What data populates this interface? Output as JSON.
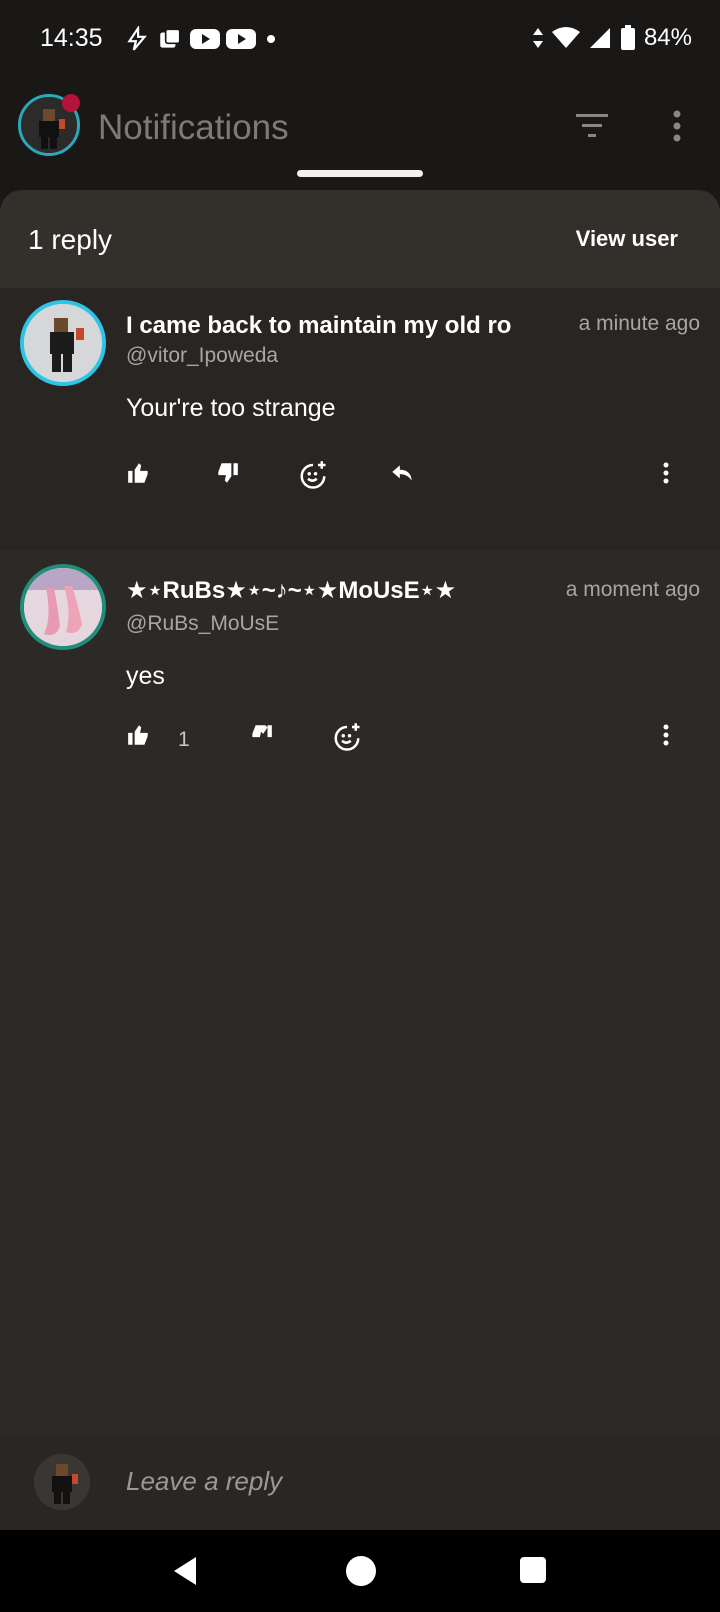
{
  "status_bar": {
    "time": "14:35",
    "battery": "84%",
    "left_icons": [
      "bolt-icon",
      "photos-icon",
      "youtube-icon",
      "youtube-icon",
      "dot-icon"
    ],
    "right_icons": [
      "data-arrows-icon",
      "wifi-icon",
      "signal-icon",
      "battery-icon"
    ]
  },
  "app_bar": {
    "title": "Notifications",
    "accent_color": "#2aa9b8",
    "badge_color": "#b3123a"
  },
  "sheet": {
    "title": "1 reply",
    "view_user_label": "View user"
  },
  "comments": [
    {
      "name": "I came back to maintain my old ro",
      "handle": "@vitor_Ipoweda",
      "time": "a minute ago",
      "body": "Your're too strange",
      "like_count": "",
      "ring_color": "#2ec4e6"
    },
    {
      "name": "★⋆RuBs★⋆~♪~⋆★MoUsE⋆★",
      "handle": "@RuBs_MoUsE",
      "time": "a moment ago",
      "body": "yes",
      "like_count": "1",
      "ring_color": "#1f8f7a"
    }
  ],
  "reply_bar": {
    "placeholder": "Leave a reply"
  },
  "nav": {
    "icons": [
      "back-icon",
      "home-icon",
      "recents-icon"
    ]
  }
}
